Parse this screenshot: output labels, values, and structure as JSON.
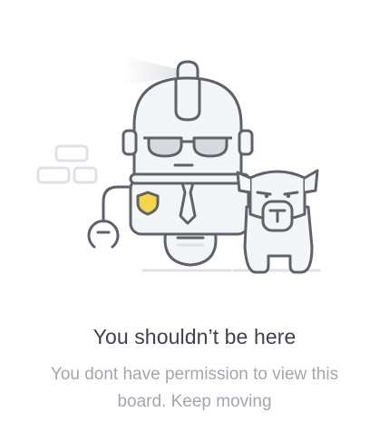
{
  "empty_state": {
    "illustration_icon": "robot-guard-with-dog-icon",
    "title": "You shouldn’t be here",
    "message": "You dont have permission to view this board. Keep moving"
  },
  "colors": {
    "outline": "#5e626b",
    "fill": "#f4f5f7",
    "badge": "#f5d547",
    "title": "#3f424a",
    "message": "#a3a6ad",
    "decor": "#dfe1e6"
  }
}
